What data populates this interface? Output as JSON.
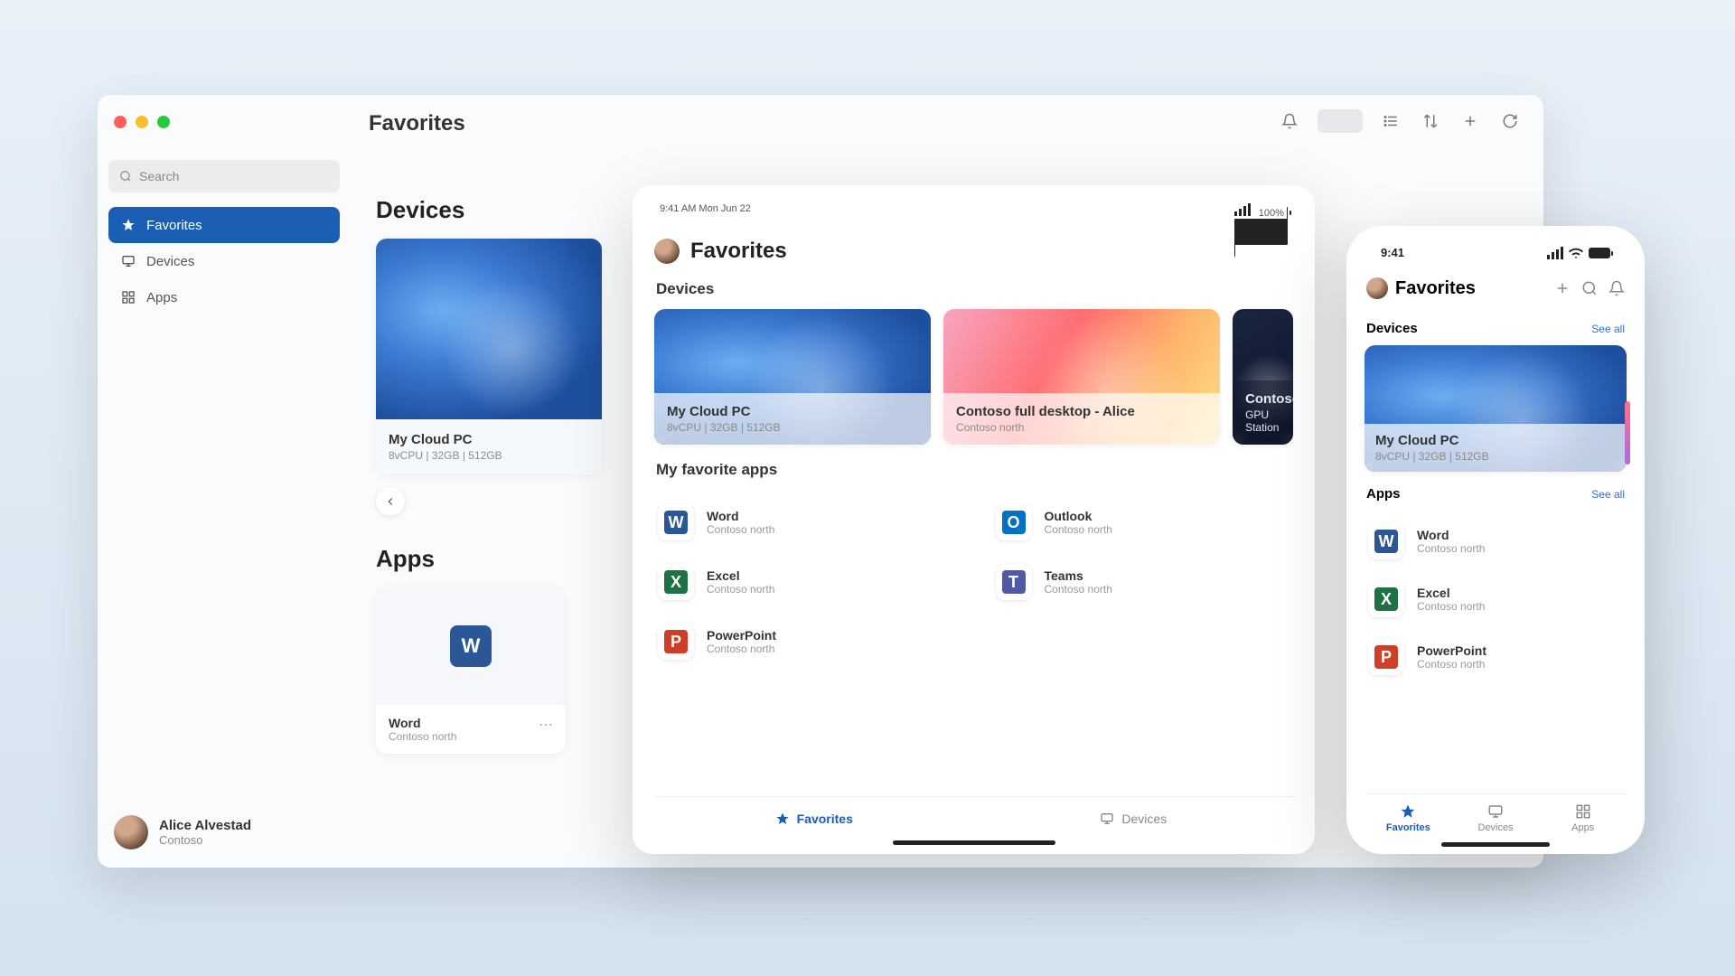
{
  "desktop": {
    "header_title": "Favorites",
    "search_placeholder": "Search",
    "sidebar": {
      "items": [
        {
          "label": "Favorites",
          "icon": "star-icon",
          "active": true
        },
        {
          "label": "Devices",
          "icon": "monitor-icon",
          "active": false
        },
        {
          "label": "Apps",
          "icon": "grid-icon",
          "active": false
        }
      ]
    },
    "user": {
      "name": "Alice Alvestad",
      "org": "Contoso"
    },
    "sections": {
      "devices_title": "Devices",
      "apps_title": "Apps"
    },
    "devices": [
      {
        "name": "My Cloud PC",
        "spec": "8vCPU | 32GB | 512GB"
      }
    ],
    "apps": [
      {
        "name": "Word",
        "org": "Contoso north",
        "color": "#2b5797",
        "glyph": "W"
      }
    ],
    "toolbar_icons": [
      "bell-icon",
      "segmented-view",
      "list-icon",
      "sort-icon",
      "add-icon",
      "refresh-icon"
    ]
  },
  "tablet": {
    "status_left": "9:41 AM   Mon Jun 22",
    "battery_text": "100%",
    "title": "Favorites",
    "sections": {
      "devices": "Devices",
      "apps": "My favorite apps"
    },
    "devices": [
      {
        "name": "My Cloud PC",
        "spec": "8vCPU | 32GB | 512GB",
        "theme": "bloom"
      },
      {
        "name": "Contoso full desktop - Alice",
        "spec": "Contoso north",
        "theme": "wave"
      },
      {
        "name": "Contoso",
        "spec": "GPU Station",
        "theme": "dark"
      }
    ],
    "apps": [
      {
        "name": "Word",
        "org": "Contoso north",
        "color": "#2b5797",
        "glyph": "W"
      },
      {
        "name": "Outlook",
        "org": "Contoso north",
        "color": "#0072c6",
        "glyph": "O"
      },
      {
        "name": "Excel",
        "org": "Contoso north",
        "color": "#1e7145",
        "glyph": "X"
      },
      {
        "name": "Teams",
        "org": "Contoso north",
        "color": "#5059a5",
        "glyph": "T"
      },
      {
        "name": "PowerPoint",
        "org": "Contoso north",
        "color": "#cf3e27",
        "glyph": "P"
      }
    ],
    "tabs": [
      {
        "label": "Favorites",
        "icon": "star-icon",
        "active": true
      },
      {
        "label": "Devices",
        "icon": "monitor-icon",
        "active": false
      }
    ]
  },
  "phone": {
    "status_time": "9:41",
    "title": "Favorites",
    "see_all": "See all",
    "sections": {
      "devices": "Devices",
      "apps": "Apps"
    },
    "devices": [
      {
        "name": "My Cloud PC",
        "spec": "8vCPU | 32GB | 512GB"
      }
    ],
    "apps": [
      {
        "name": "Word",
        "org": "Contoso north",
        "color": "#2b5797",
        "glyph": "W"
      },
      {
        "name": "Excel",
        "org": "Contoso north",
        "color": "#1e7145",
        "glyph": "X"
      },
      {
        "name": "PowerPoint",
        "org": "Contoso north",
        "color": "#cf3e27",
        "glyph": "P"
      }
    ],
    "tabs": [
      {
        "label": "Favorites",
        "icon": "star-icon",
        "active": true
      },
      {
        "label": "Devices",
        "icon": "monitor-icon",
        "active": false
      },
      {
        "label": "Apps",
        "icon": "grid-icon",
        "active": false
      }
    ],
    "header_icons": [
      "add-icon",
      "search-icon",
      "bell-icon"
    ]
  },
  "colors": {
    "accent": "#1a5fb4"
  }
}
